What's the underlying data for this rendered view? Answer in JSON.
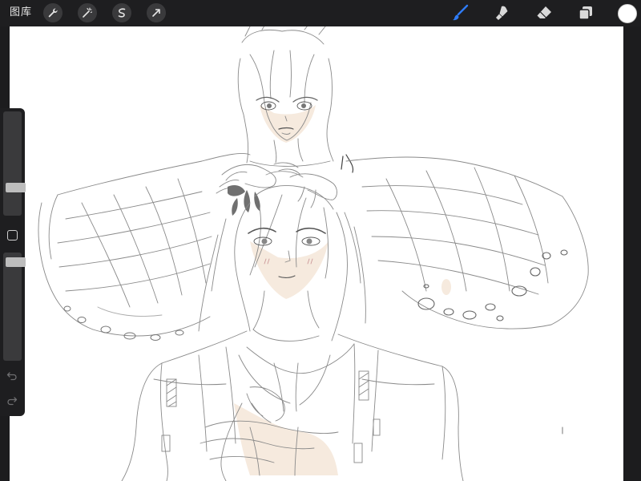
{
  "toolbar": {
    "gallery_label": "图库",
    "left_tools": [
      {
        "icon": "wrench-icon"
      },
      {
        "icon": "magic-wand-icon"
      },
      {
        "icon": "selection-icon"
      },
      {
        "icon": "transform-arrow-icon"
      }
    ],
    "right_tools": [
      {
        "icon": "brush-icon",
        "active": true
      },
      {
        "icon": "smudge-icon",
        "active": false
      },
      {
        "icon": "eraser-icon",
        "active": false
      },
      {
        "icon": "layers-icon",
        "active": false
      }
    ],
    "active_color": "#ffffff",
    "accent_color": "#2f7cf6"
  },
  "sidebar": {
    "brush_size_level": 0.25,
    "opacity_level": 0.95,
    "modify_button": "square-icon",
    "undo": "undo-icon",
    "redo": "redo-icon"
  }
}
